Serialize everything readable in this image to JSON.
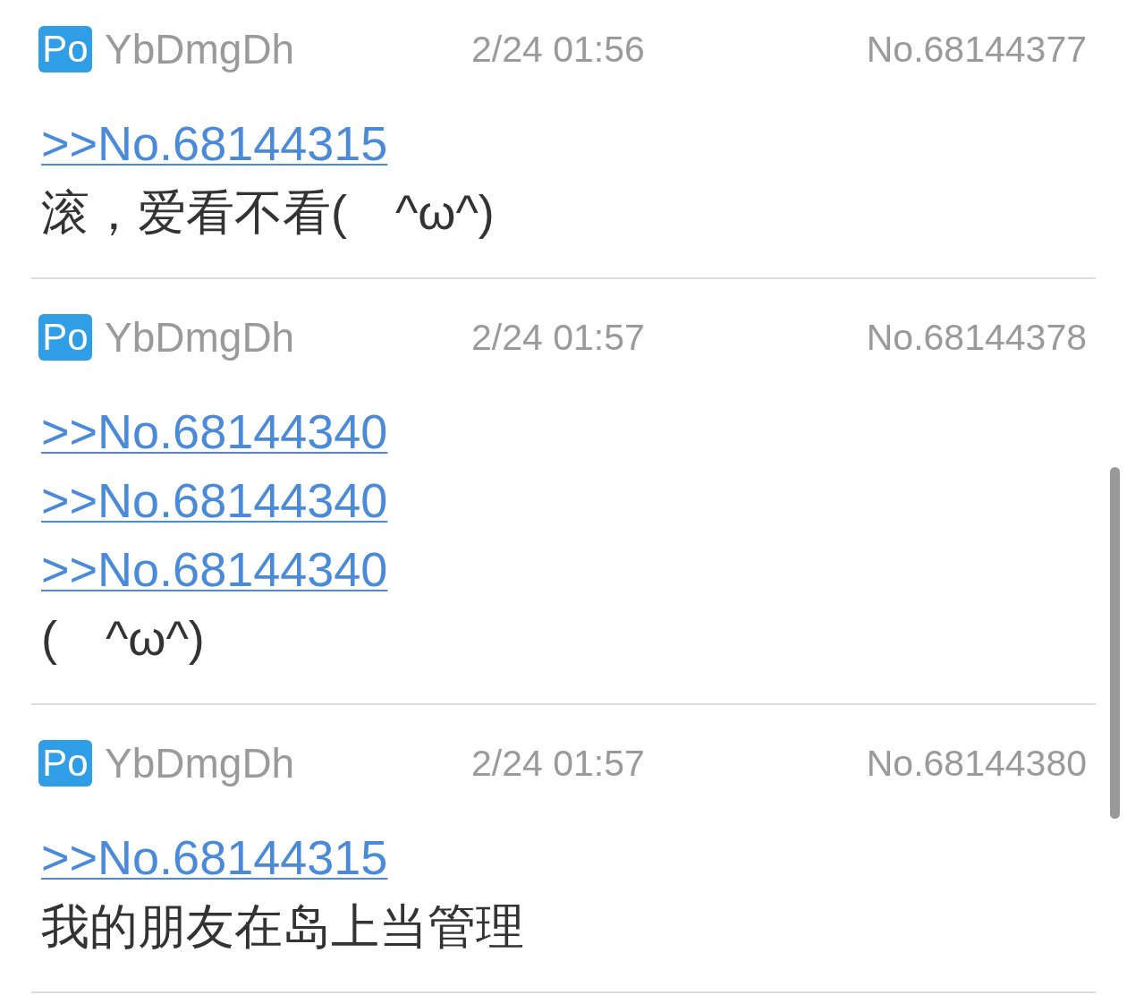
{
  "posts": [
    {
      "badge": "Po",
      "user": "YbDmgDh",
      "date": "2/24 01:56",
      "number": "No.68144377",
      "quotes": [
        ">>No.68144315"
      ],
      "text": "滚，爱看不看(　^ω^)"
    },
    {
      "badge": "Po",
      "user": "YbDmgDh",
      "date": "2/24 01:57",
      "number": "No.68144378",
      "quotes": [
        ">>No.68144340",
        ">>No.68144340",
        ">>No.68144340"
      ],
      "text": "(　^ω^)"
    },
    {
      "badge": "Po",
      "user": "YbDmgDh",
      "date": "2/24 01:57",
      "number": "No.68144380",
      "quotes": [
        ">>No.68144315"
      ],
      "text": "我的朋友在岛上当管理"
    }
  ]
}
